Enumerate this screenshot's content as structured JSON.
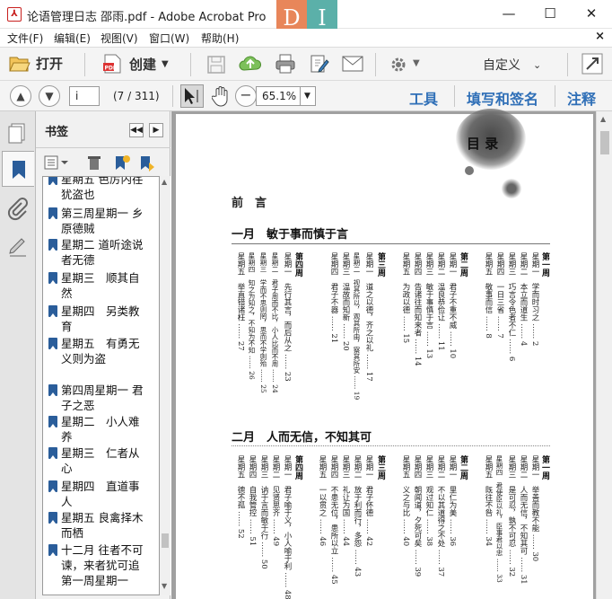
{
  "window": {
    "title": "论语管理日志 邵雨.pdf - Adobe Acrobat Pro",
    "logo_letters": [
      "D",
      "I"
    ],
    "minimize": "—",
    "maximize": "☐",
    "close": "✕"
  },
  "menu": [
    "文件(F)",
    "编辑(E)",
    "视图(V)",
    "窗口(W)",
    "帮助(H)"
  ],
  "menu_close": "×",
  "toolbar": {
    "open": "打开",
    "create": "创建",
    "customize": "自定义"
  },
  "nav": {
    "page_input": "i",
    "page_count": "(7 / 311)",
    "zoom": "65.1%",
    "tools": "工具",
    "fill_sign": "填写和签名",
    "comment": "注释"
  },
  "bookmarks": {
    "header": "书签",
    "items": [
      "星期五 色厉内荏犹盗也",
      "第三周星期一 乡原德贼",
      "星期二 道听途说者无德",
      "星期三　顺其自然",
      "星期四　另类教育",
      "星期五　有勇无义则为盗",
      "第四周星期一 君子之恶",
      "星期二　小人难养",
      "星期三　仁者从心",
      "星期四　直道事人",
      "星期五 良禽择木而栖",
      "十二月 往者不可谏，来者犹可追第一周星期一"
    ]
  },
  "doc": {
    "seal": "目 录",
    "preface": "前　言",
    "months": [
      {
        "title": "一月　敏于事而慎于言",
        "weeks": [
          {
            "label": "第一周",
            "entries": [
              "星期一　学而时习之 …… 2",
              "星期二　本立而道生 …… 4",
              "星期三　巧言令色者不仁 …… 6",
              "星期四　一日三省 …… 7",
              "星期五　敬事而信 …… 8"
            ]
          },
          {
            "label": "第二周",
            "entries": [
              "星期一　君子不重不威 …… 10",
              "星期二　温良恭俭让 …… 11",
              "星期三　敏于事慎于言 …… 13",
              "星期四　告诸往而知来者 …… 14",
              "星期五　为政以德 …… 15"
            ]
          },
          {
            "label": "第三周",
            "entries": [
              "星期一　道之以德，齐之以礼 …… 17",
              "星期二　视其所以，观其所由，察其所安 …… 19",
              "星期三　温故而知新 …… 20",
              "星期四　君子不器 …… 21"
            ]
          },
          {
            "label": "第四周",
            "entries": [
              "星期一　先行其言，而后从之 …… 23",
              "星期二　君子周而不比，小人比而不周 …… 24",
              "星期三　学而不思则罔，思而不学则殆 …… 25",
              "星期四　知之为知之，不知为不知 …… 26",
              "星期五　举直错诸枉 …… 27"
            ]
          }
        ]
      },
      {
        "title": "二月　人而无信，不知其可",
        "weeks": [
          {
            "label": "第一周",
            "entries": [
              "星期一　举善而教不能 …… 30",
              "星期二　人而无信，不知其可 …… 31",
              "星期三　是可忍，孰不可忍 …… 32",
              "星期四　君使臣以礼，臣事君以忠 …… 33",
              "星期五　既往不咎 …… 34"
            ]
          },
          {
            "label": "第二周",
            "entries": [
              "星期一　里仁为美 …… 36",
              "星期二　不以其道得之不处 …… 37",
              "星期三　观过知仁 …… 38",
              "星期四　朝闻道，夕死可矣 …… 39",
              "星期五　义之与比 …… 40"
            ]
          },
          {
            "label": "第三周",
            "entries": [
              "星期一　君子怀德 …… 42",
              "星期二　放于利而行，多怨 …… 43",
              "星期三　礼让为国 …… 44",
              "星期四　不患无位，患所以立 …… 45",
              "星期五　一以贯之 …… 46"
            ]
          },
          {
            "label": "第四周",
            "entries": [
              "星期一　君子喻于义，小人喻于利 …… 48",
              "星期二　见贤思齐 …… 49",
              "星期三　讷于言而敏于行 …… 50",
              "星期四　自我管控 …… 51",
              "星期五　德不孤 …… 52"
            ]
          }
        ]
      }
    ]
  }
}
